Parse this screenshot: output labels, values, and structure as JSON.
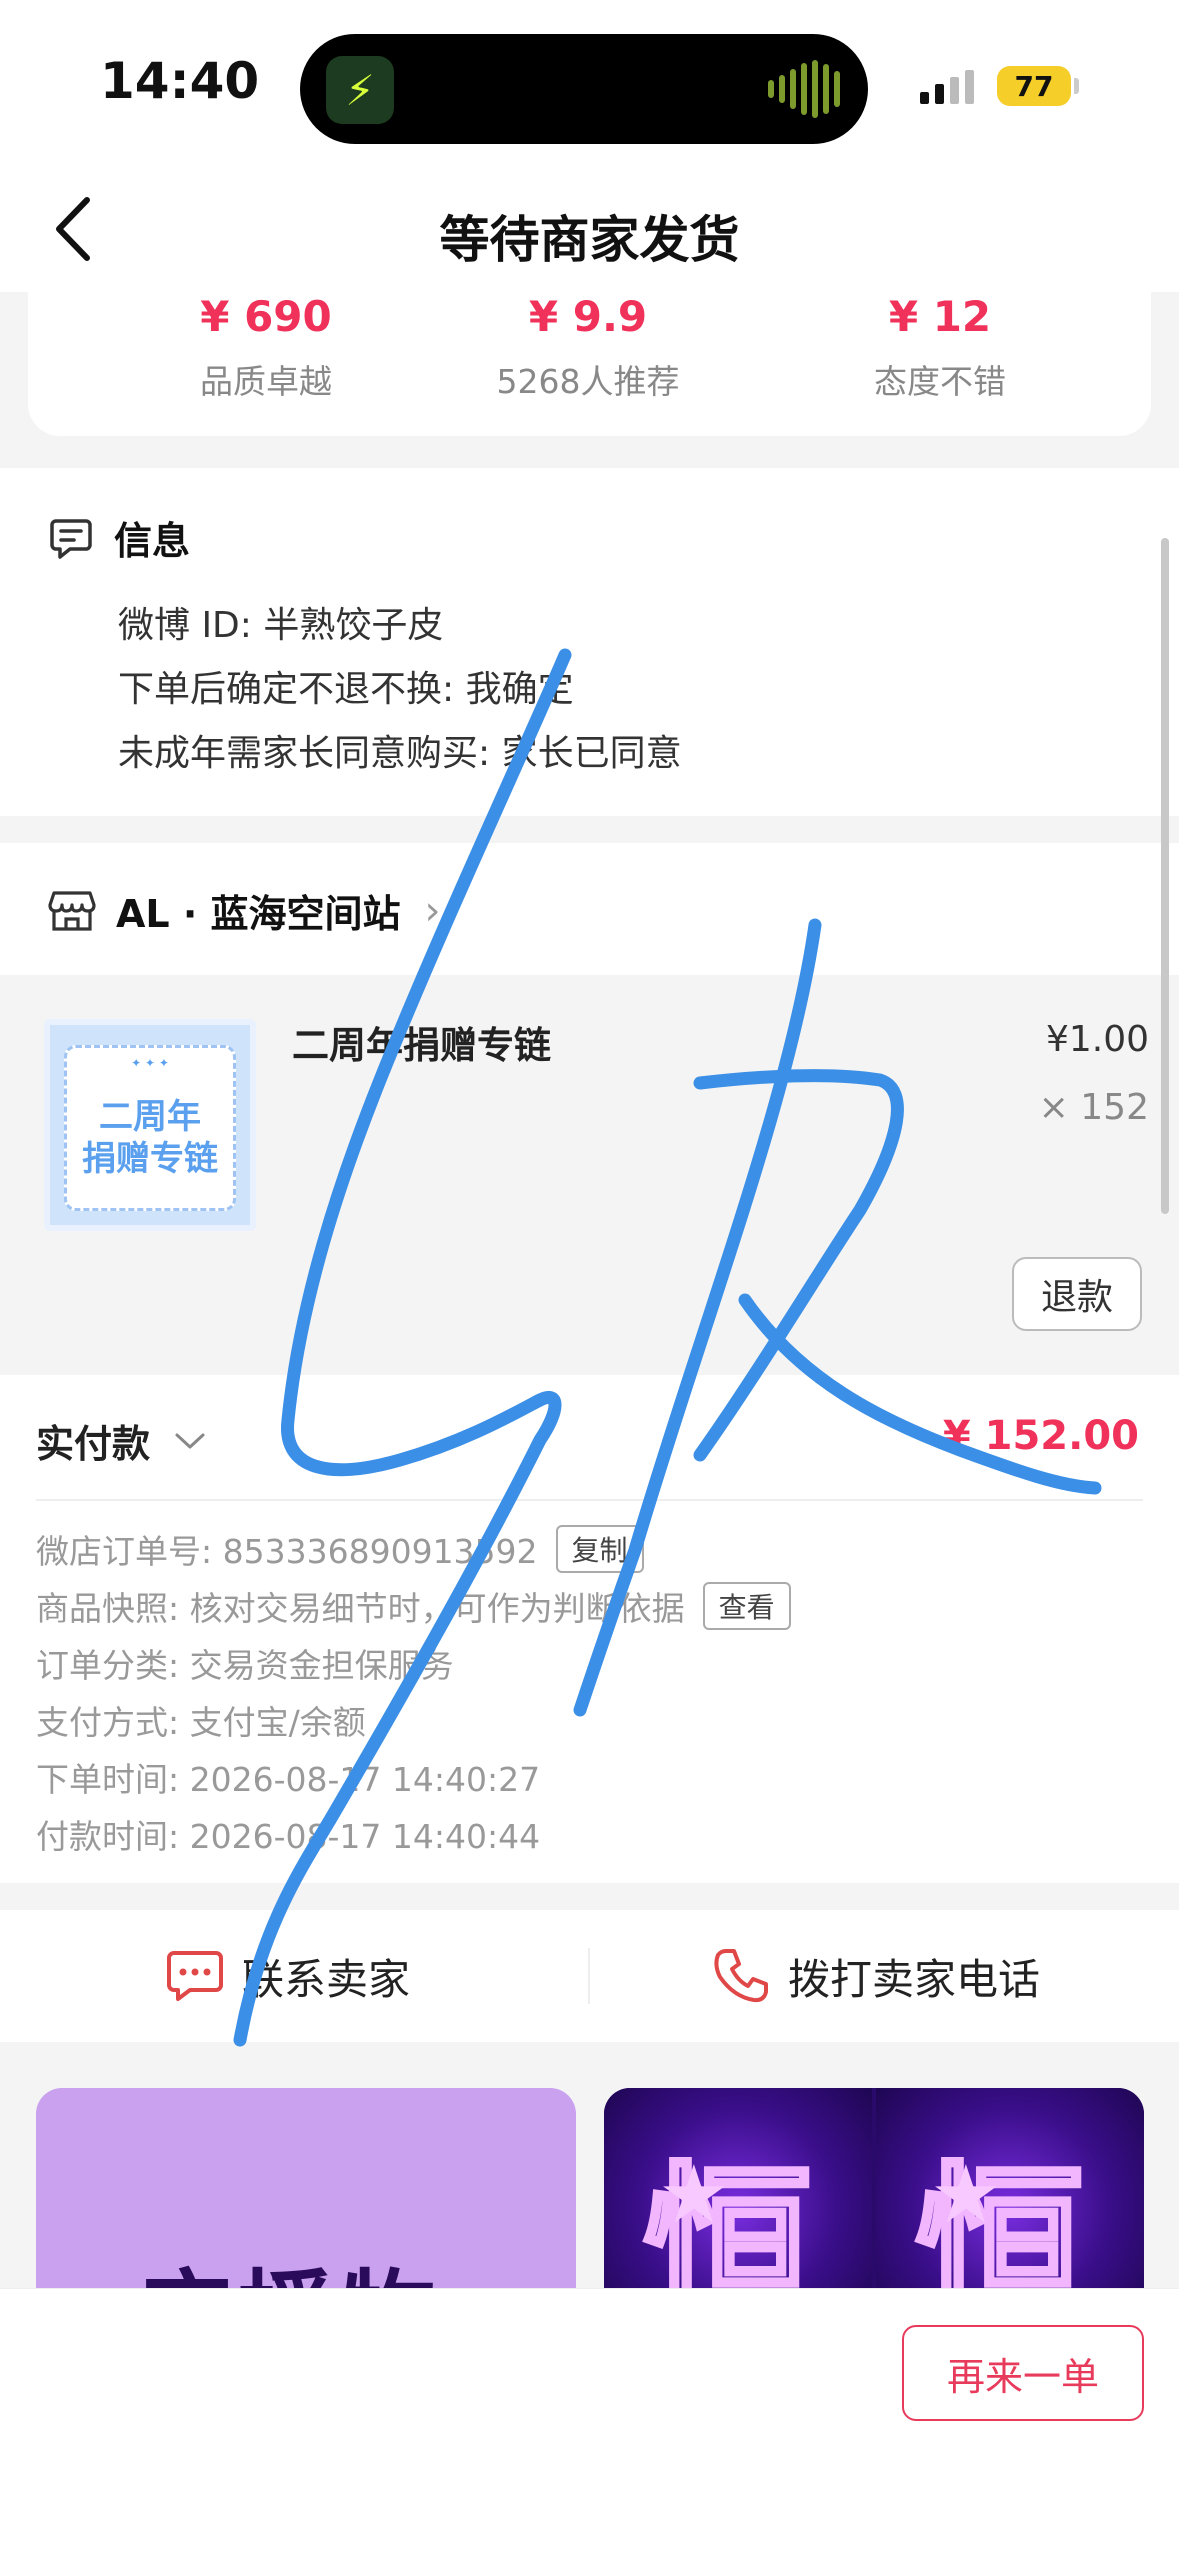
{
  "status_bar": {
    "time": "14:40",
    "battery": "77"
  },
  "nav": {
    "title": "等待商家发货"
  },
  "stats": [
    {
      "value": "¥ 690",
      "label": "品质卓越"
    },
    {
      "value": "¥ 9.9",
      "label": "5268人推荐"
    },
    {
      "value": "¥ 12",
      "label": "态度不错"
    }
  ],
  "info": {
    "title": "信息",
    "lines": [
      "微博 ID: 半熟饺子皮",
      "下单后确定不退不换: 我确定",
      "未成年需家长同意购买: 家长已同意"
    ]
  },
  "shop": {
    "name": "AL · 蓝海空间站"
  },
  "product": {
    "name": "二周年捐赠专链",
    "price": "¥1.00",
    "quantity": "× 152",
    "thumb_text_1": "二周年",
    "thumb_text_2": "捐赠专链",
    "refund_label": "退款"
  },
  "payment": {
    "label": "实付款",
    "amount": "¥ 152.00",
    "order_no": "微店订单号:  853336890913592",
    "copy_label": "复制",
    "snapshot": "商品快照: 核对交易细节时，可作为判断依据",
    "view_label": "查看",
    "category": "订单分类:  交易资金担保服务",
    "method": "支付方式:  支付宝/余额",
    "order_time": "下单时间:  2026-08-17 14:40:27",
    "pay_time": "付款时间:  2026-08-17 14:40:44"
  },
  "contact": {
    "seller": "联系卖家",
    "phone": "拨打卖家电话"
  },
  "recommend": {
    "left_text": "应援物",
    "right_char": "恒"
  },
  "bottom": {
    "reorder": "再来一单"
  },
  "colors": {
    "accent_red": "#f0315a",
    "handwriting_blue": "#3b8fe6"
  }
}
